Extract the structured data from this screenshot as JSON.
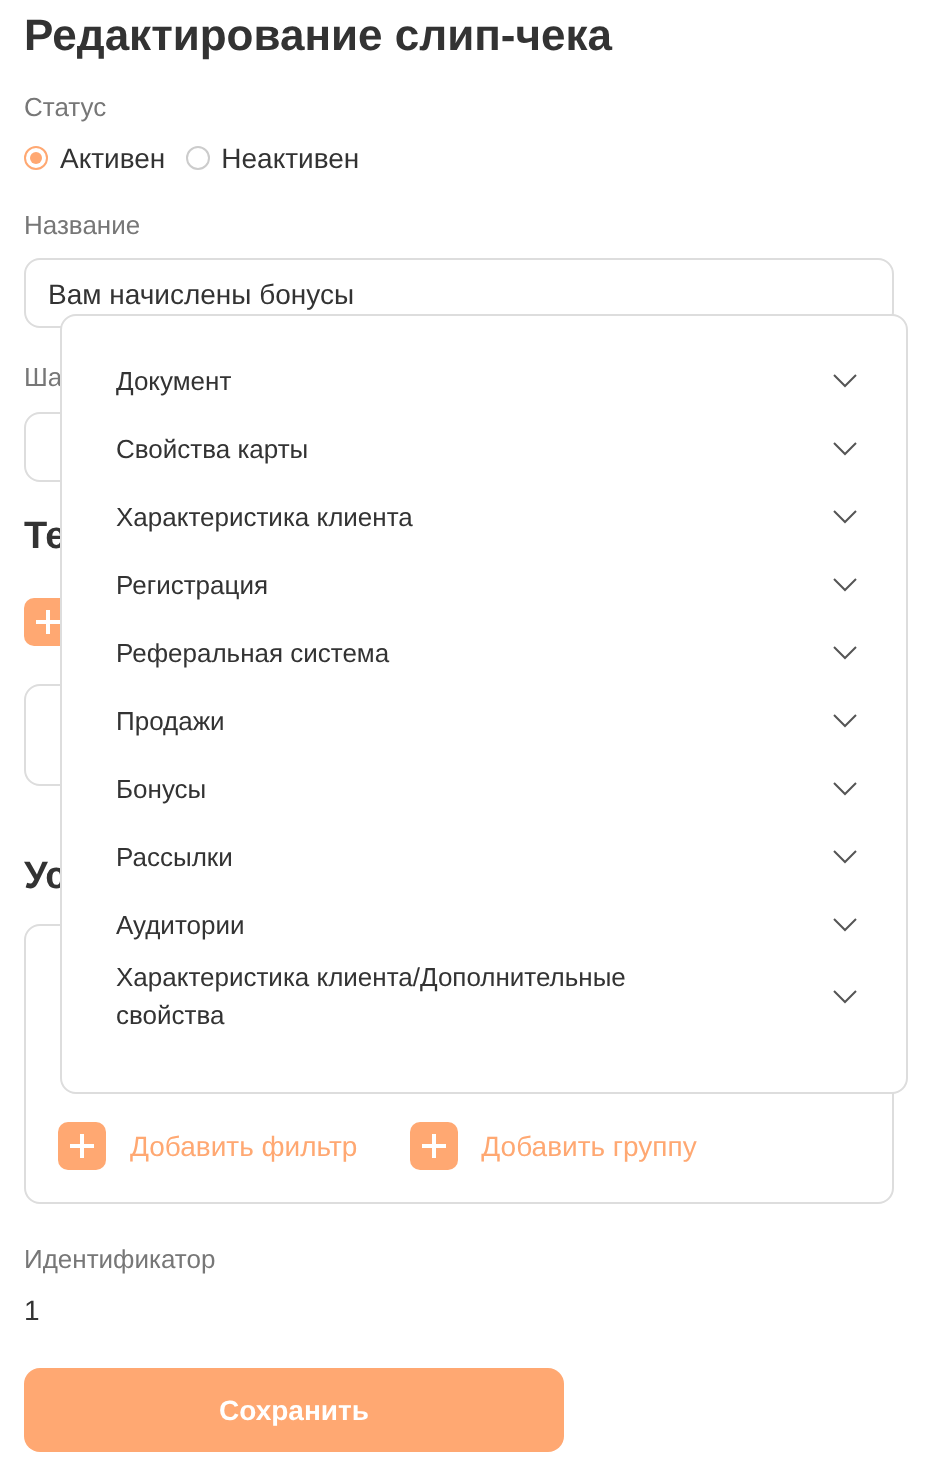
{
  "page_title": "Редактирование слип-чека",
  "status": {
    "label": "Статус",
    "options": [
      {
        "label": "Активен",
        "selected": true
      },
      {
        "label": "Неактивен",
        "selected": false
      }
    ]
  },
  "name_field": {
    "label": "Название",
    "value": "Вам начислены бонусы"
  },
  "template_field": {
    "label": "Ша"
  },
  "text_section": {
    "heading": "Те"
  },
  "conditions_section": {
    "heading": "Ус",
    "buttons": [
      "Добавить фильтр",
      "Добавить группу"
    ]
  },
  "identifier": {
    "label": "Идентификатор",
    "value": "1"
  },
  "save_button": "Сохранить",
  "dropdown": {
    "items": [
      {
        "label": "Документ",
        "expanded": false
      },
      {
        "label": "Свойства карты",
        "expanded": false
      },
      {
        "label": "Характеристика клиента",
        "expanded": false
      },
      {
        "label": "Регистрация",
        "expanded": false
      },
      {
        "label": "Реферальная система",
        "expanded": false
      },
      {
        "label": "Продажи",
        "expanded": false
      },
      {
        "label": "Бонусы",
        "expanded": false
      },
      {
        "label": "Рассылки",
        "expanded": false
      },
      {
        "label": "Аудитории",
        "expanded": false
      },
      {
        "label": "Характеристика клиента/Дополнительные свойства",
        "expanded": false
      }
    ]
  }
}
